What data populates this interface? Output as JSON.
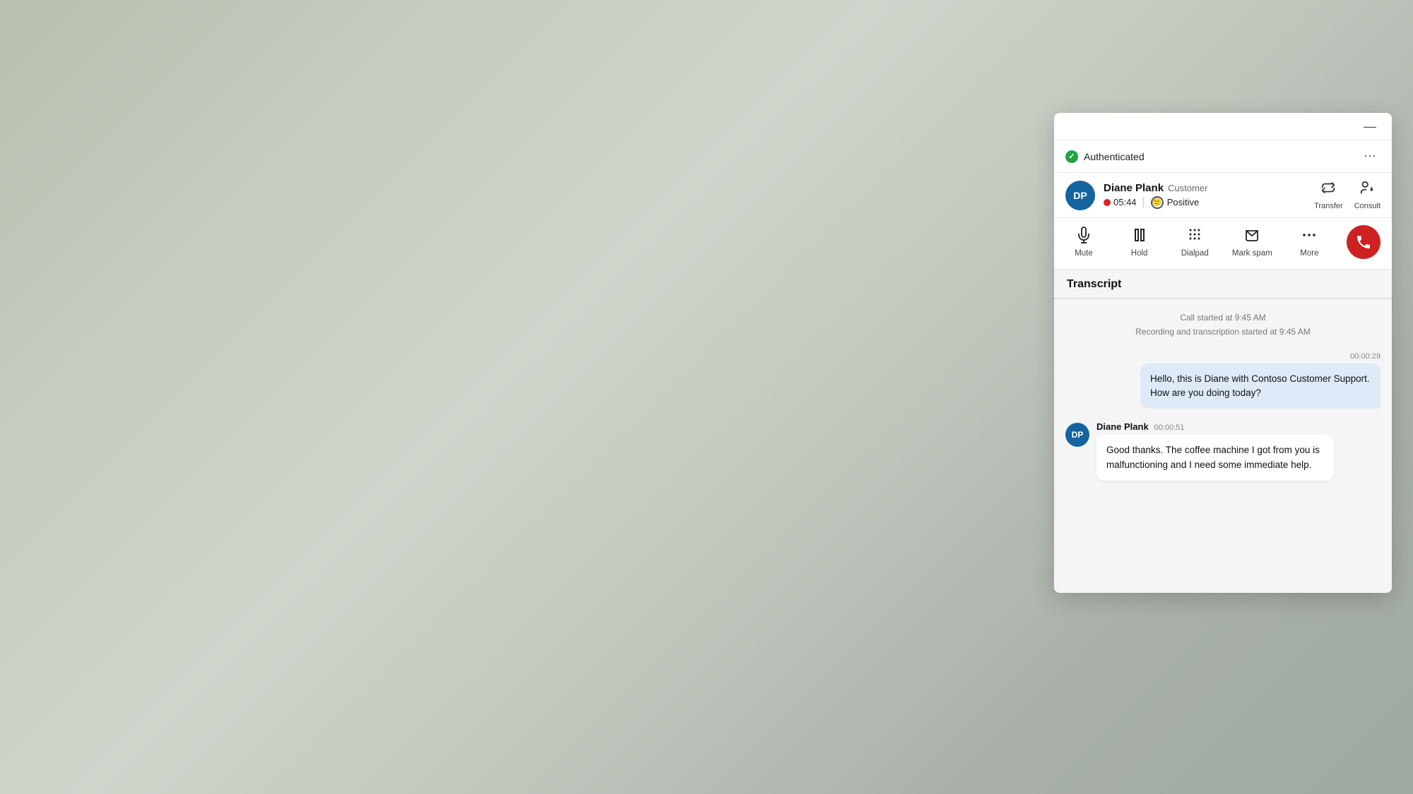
{
  "background": {
    "color": "#c8cfc8"
  },
  "panel": {
    "minimize_label": "—",
    "auth": {
      "status_label": "Authenticated",
      "more_icon": "⋯"
    },
    "contact": {
      "avatar_initials": "DP",
      "name": "Diane Plank",
      "role": "Customer",
      "timer": "05:44",
      "sentiment": "Positive",
      "transfer_label": "Transfer",
      "consult_label": "Consult"
    },
    "controls": {
      "mute_label": "Mute",
      "hold_label": "Hold",
      "dialpad_label": "Dialpad",
      "mark_spam_label": "Mark spam",
      "more_label": "More"
    },
    "transcript": {
      "header": "Transcript",
      "call_started": "Call started at 9:45 AM",
      "recording_started": "Recording and transcription started at 9:45 AM",
      "messages": [
        {
          "type": "agent",
          "time": "00:00:29",
          "text": "Hello, this is Diane with Contoso Customer Support. How are you doing today?"
        },
        {
          "type": "customer",
          "avatar": "DP",
          "name": "Diane Plank",
          "time": "00:00:51",
          "text": "Good thanks. The coffee machine I got from you is malfunctioning and I need some immediate help."
        }
      ]
    }
  }
}
